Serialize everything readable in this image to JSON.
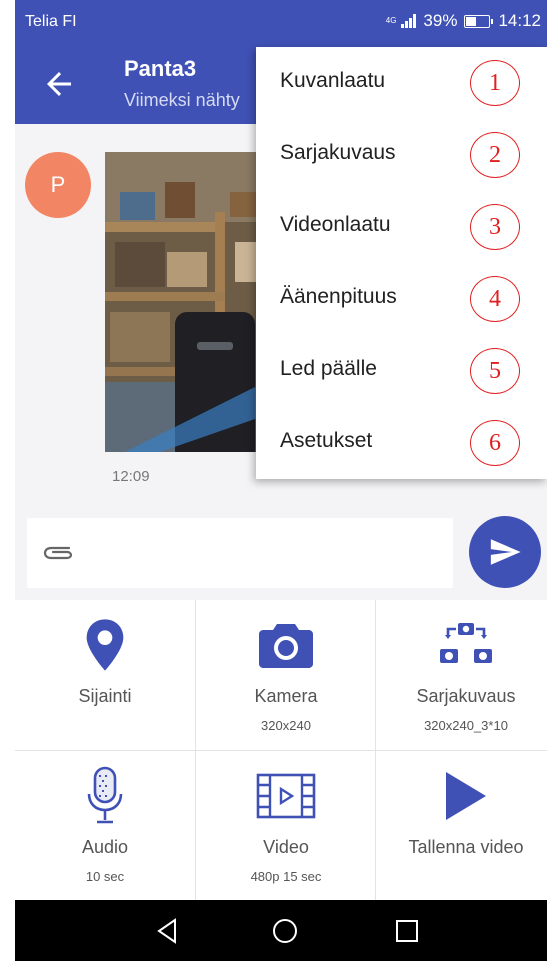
{
  "status_bar": {
    "carrier": "Telia FI",
    "network": "4G",
    "battery": "39%",
    "battery_level": 0.39,
    "time": "14:12"
  },
  "header": {
    "back_icon": "arrow-left-icon",
    "title": "Panta3",
    "subtitle": "Viimeksi nähty"
  },
  "chat": {
    "avatar_letter": "P",
    "message_time": "12:09"
  },
  "composer": {
    "attach_icon": "paperclip-icon",
    "placeholder": "",
    "send_icon": "send-icon"
  },
  "actions": [
    {
      "label": "Sijainti",
      "sub": "",
      "icon": "location-pin-icon"
    },
    {
      "label": "Kamera",
      "sub": "320x240",
      "icon": "camera-icon"
    },
    {
      "label": "Sarjakuvaus",
      "sub": "320x240_3*10",
      "icon": "burst-camera-icon"
    },
    {
      "label": "Audio",
      "sub": "10 sec",
      "icon": "microphone-icon"
    },
    {
      "label": "Video",
      "sub": "480p 15 sec",
      "icon": "video-film-icon"
    },
    {
      "label": "Tallenna video",
      "sub": "",
      "icon": "play-icon"
    }
  ],
  "menu": {
    "items": [
      {
        "label": "Kuvanlaatu",
        "number": "1"
      },
      {
        "label": "Sarjakuvaus",
        "number": "2"
      },
      {
        "label": "Videonlaatu",
        "number": "3"
      },
      {
        "label": "Äänenpituus",
        "number": "4"
      },
      {
        "label": "Led päälle",
        "number": "5"
      },
      {
        "label": "Asetukset",
        "number": "6"
      }
    ]
  },
  "nav_bar": {
    "back_icon": "nav-back-icon",
    "home_icon": "nav-home-icon",
    "recents_icon": "nav-recents-icon"
  },
  "colors": {
    "primary": "#3f51b5",
    "avatar": "#f28664",
    "annotation": "#e02020"
  }
}
